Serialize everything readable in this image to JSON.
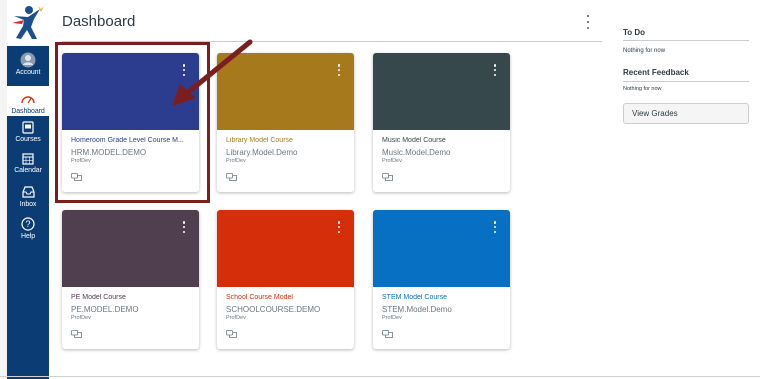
{
  "nav": {
    "items": [
      {
        "label": "Account",
        "icon": "account-icon"
      },
      {
        "label": "Dashboard",
        "icon": "dashboard-icon"
      },
      {
        "label": "Courses",
        "icon": "courses-icon"
      },
      {
        "label": "Calendar",
        "icon": "calendar-icon"
      },
      {
        "label": "Inbox",
        "icon": "inbox-icon"
      },
      {
        "label": "Help",
        "icon": "help-icon"
      }
    ]
  },
  "header": {
    "title": "Dashboard"
  },
  "cards": [
    {
      "name": "Homeroom Grade Level Course M...",
      "code": "HRM.MODEL.DEMO",
      "term": "ProfDev",
      "color": "#2c3d8f",
      "name_color": "#2c3d8f"
    },
    {
      "name": "Library Model Course",
      "code": "Library.Model.Demo",
      "term": "ProfDev",
      "color": "#a67a1c",
      "name_color": "#a67a1c"
    },
    {
      "name": "Music Model Course",
      "code": "Music.Model.Demo",
      "term": "ProfDev",
      "color": "#36484b",
      "name_color": "#36484b"
    },
    {
      "name": "PE Model Course",
      "code": "PE.MODEL.DEMO",
      "term": "ProfDev",
      "color": "#4f3f4f",
      "name_color": "#4f3f4f"
    },
    {
      "name": "School Course Model",
      "code": "SCHOOLCOURSE.DEMO",
      "term": "ProfDev",
      "color": "#d52e0a",
      "name_color": "#d52e0a"
    },
    {
      "name": "STEM Model Course",
      "code": "STEM.Model.Demo",
      "term": "ProfDev",
      "color": "#0770c2",
      "name_color": "#0770c2"
    }
  ],
  "sidebar": {
    "todo_title": "To Do",
    "todo_empty": "Nothing for now",
    "recent_title": "Recent Feedback",
    "recent_empty": "Nothing for now",
    "view_grades_label": "View Grades"
  },
  "annotation": {
    "highlight_color": "#7a1e1e"
  }
}
